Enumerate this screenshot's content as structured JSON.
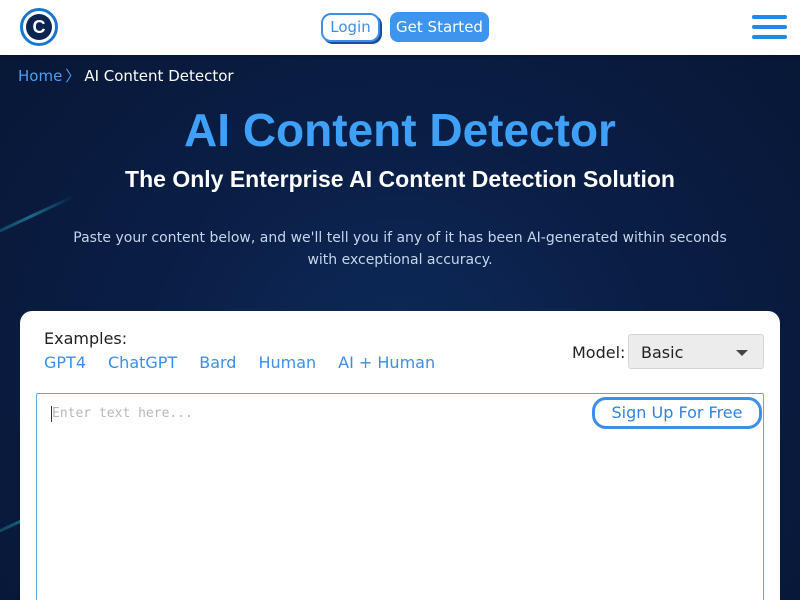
{
  "header": {
    "logo_letter": "C",
    "login_label": "Login",
    "get_started_label": "Get Started"
  },
  "breadcrumb": {
    "home": "Home",
    "separator": "〉",
    "current": "AI Content Detector"
  },
  "hero": {
    "title": "AI Content Detector",
    "subtitle": "The Only Enterprise AI Content Detection Solution",
    "description": "Paste your content below, and we'll tell you if any of it has been AI-generated within seconds with exceptional accuracy."
  },
  "detector": {
    "examples_label": "Examples:",
    "examples": [
      "GPT4",
      "ChatGPT",
      "Bard",
      "Human",
      "AI + Human"
    ],
    "model_label": "Model:",
    "model_value": "Basic",
    "text_placeholder": "Enter text here...",
    "signup_label": "Sign Up For Free"
  },
  "colors": {
    "accent": "#3d8ee8",
    "title_blue": "#3fa0f8",
    "background": "#0a1e45"
  },
  "icons": [
    "logo-icon",
    "hamburger-menu-icon",
    "caret-down-icon"
  ]
}
